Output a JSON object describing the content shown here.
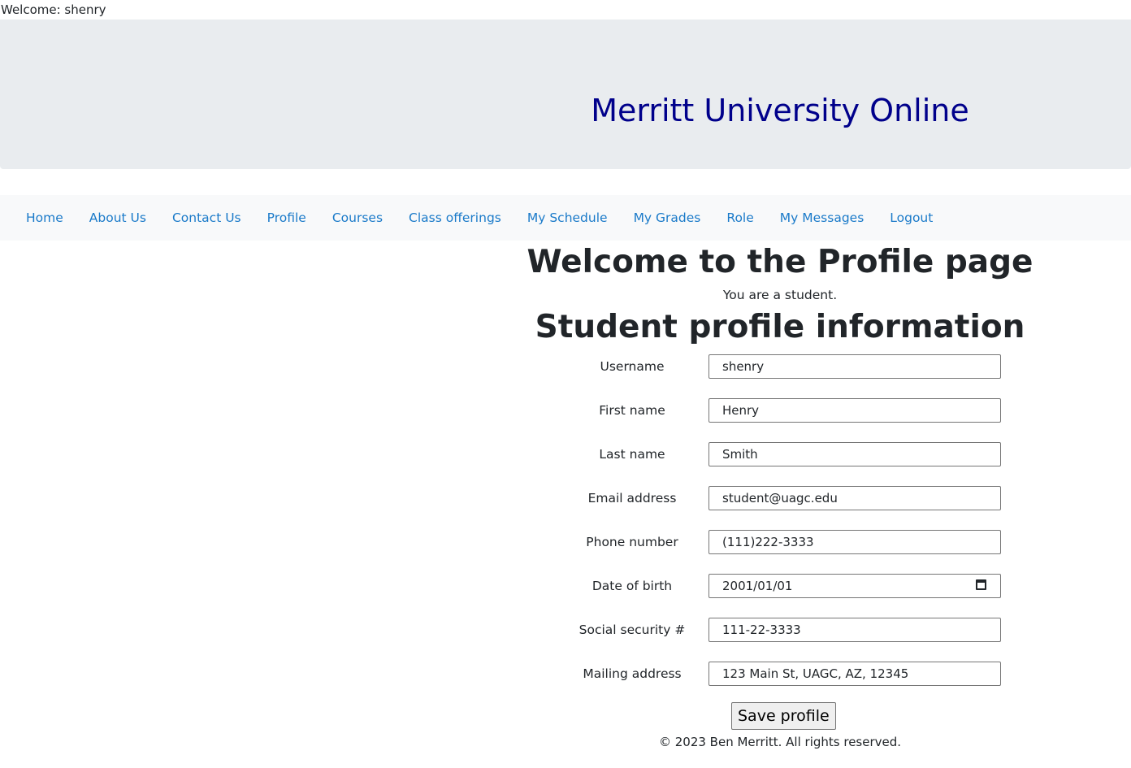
{
  "header": {
    "welcome_text": "Welcome: shenry",
    "site_title": "Merritt University Online"
  },
  "colors": {
    "banner_bg": "#e9ecef",
    "title_color": "#00008b",
    "nav_bg": "#f8f9fa",
    "link_color": "#1a7ac9"
  },
  "nav": {
    "items": [
      {
        "label": "Home"
      },
      {
        "label": "About Us"
      },
      {
        "label": "Contact Us"
      },
      {
        "label": "Profile"
      },
      {
        "label": "Courses"
      },
      {
        "label": "Class offerings"
      },
      {
        "label": "My Schedule"
      },
      {
        "label": "My Grades"
      },
      {
        "label": "Role"
      },
      {
        "label": "My Messages"
      },
      {
        "label": "Logout"
      }
    ]
  },
  "main": {
    "page_heading": "Welcome to the Profile page",
    "role_text": "You are a student.",
    "section_heading": "Student profile information"
  },
  "form": {
    "username": {
      "label": "Username",
      "value": "shenry"
    },
    "first_name": {
      "label": "First name",
      "value": "Henry"
    },
    "last_name": {
      "label": "Last name",
      "value": "Smith"
    },
    "email": {
      "label": "Email address",
      "value": "student@uagc.edu"
    },
    "phone": {
      "label": "Phone number",
      "value": "(111)222-3333"
    },
    "dob": {
      "label": "Date of birth",
      "value": "2001/01/01"
    },
    "ssn": {
      "label": "Social security #",
      "value": "111-22-3333"
    },
    "address": {
      "label": "Mailing address",
      "value": "123 Main St, UAGC, AZ, 12345"
    },
    "save_label": "Save profile"
  },
  "footer": {
    "text": "© 2023 Ben Merritt. All rights reserved."
  }
}
